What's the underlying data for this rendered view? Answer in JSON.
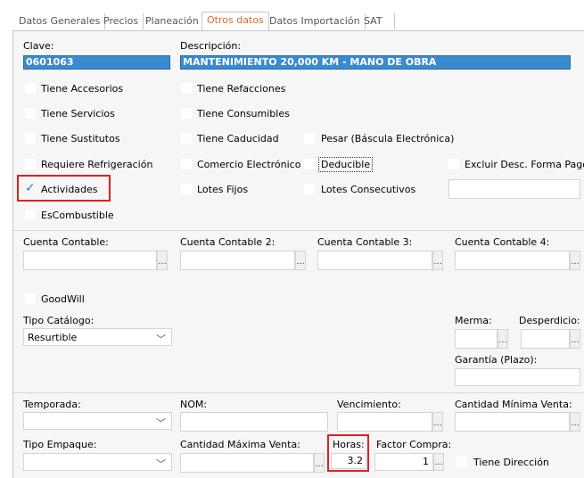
{
  "tabs": [
    "Datos Generales",
    "Precios",
    "Planeación",
    "Otros datos",
    "Datos Importación",
    "SAT"
  ],
  "active_tab": "Otros datos",
  "clave": {
    "label": "Clave:",
    "value": "0601063"
  },
  "descripcion": {
    "label": "Descripción:",
    "value": "MANTENIMIENTO 20,000 KM - MANO DE OBRA"
  },
  "checks": {
    "tiene_accesorios": "Tiene Accesorios",
    "tiene_refacciones": "Tiene Refacciones",
    "tiene_servicios": "Tiene Servicios",
    "tiene_consumibles": "Tiene Consumibles",
    "tiene_sustitutos": "Tiene Sustitutos",
    "tiene_caducidad": "Tiene Caducidad",
    "pesar": "Pesar (Báscula Electrónica)",
    "requiere_refrigeracion": "Requiere Refrigeración",
    "comercio_electronico": "Comercio Electrónico",
    "deducible": "Deducible",
    "excluir_desc": "Excluir Desc. Forma Pago",
    "actividades": "Actividades",
    "lotes_fijos": "Lotes Fijos",
    "lotes_consecutivos": "Lotes Consecutivos",
    "escombustible": "EsCombustible",
    "goodwill": "GoodWill"
  },
  "actividades_checked": true,
  "cuentas": [
    "Cuenta Contable:",
    "Cuenta Contable 2:",
    "Cuenta Contable 3:",
    "Cuenta Contable 4:"
  ],
  "ellipsis": "...",
  "tipo_catalogo": {
    "label": "Tipo Catálogo:",
    "value": "Resurtible"
  },
  "merma": "Merma:",
  "desperdicio": "Desperdicio:",
  "garantia": "Garantía (Plazo):",
  "temporada": "Temporada:",
  "nom": "NOM:",
  "vencimiento": "Vencimiento:",
  "cantidad_minima": "Cantidad Mínima Venta:",
  "tipo_empaque": "Tipo Empaque:",
  "cantidad_maxima": "Cantidad Máxima Venta:",
  "horas": {
    "label": "Horas:",
    "value": "3.2"
  },
  "factor_compra": {
    "label": "Factor Compra:",
    "value": "1"
  },
  "tiene_direccion": "Tiene Dirección",
  "colors": {
    "accent_tab": "#e06a2c",
    "selection": "#3a8ad0",
    "highlight": "#e02020",
    "check": "#2a7ad8"
  }
}
